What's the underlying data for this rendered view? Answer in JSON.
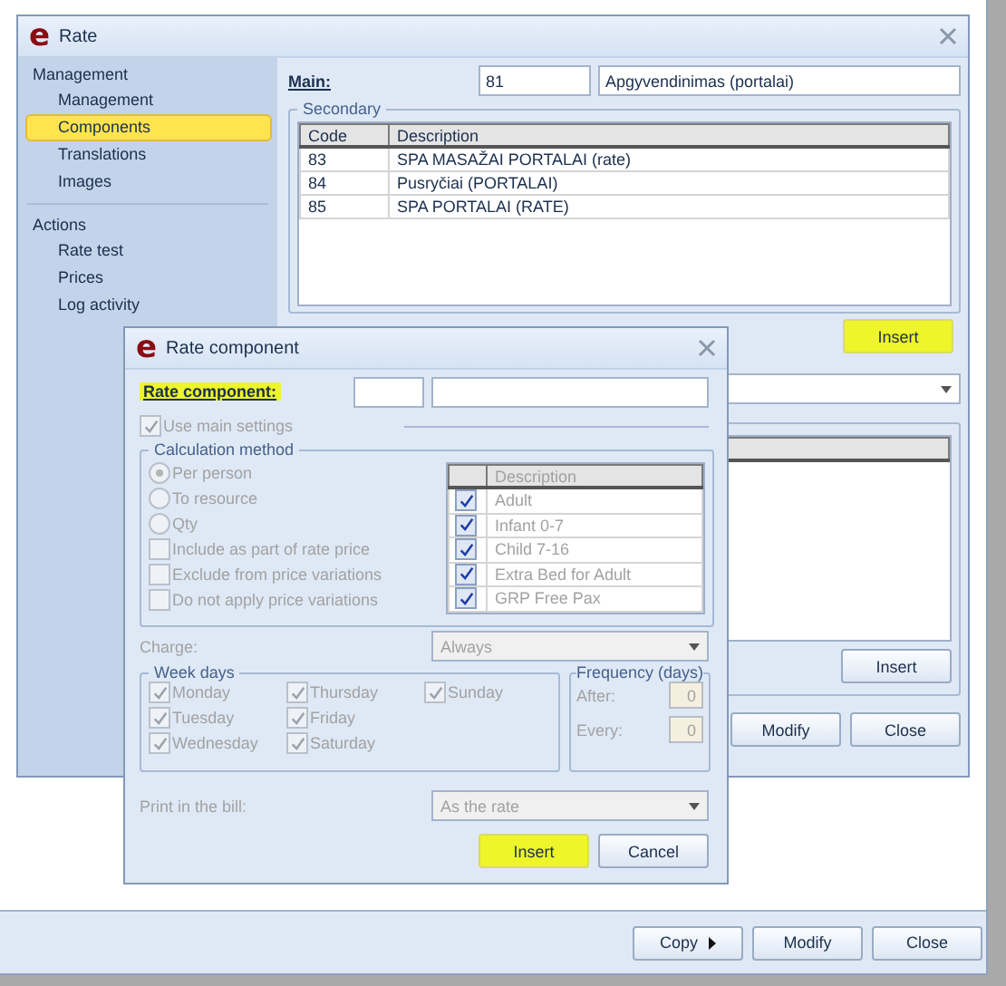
{
  "background_window": {
    "buttons": [
      {
        "label": "Copy",
        "kind": "menu"
      },
      {
        "label": "Modify",
        "kind": "plain"
      },
      {
        "label": "Close",
        "kind": "plain"
      }
    ]
  },
  "rate_window": {
    "logo": "e",
    "title": "Rate",
    "sidebar": {
      "sections": [
        {
          "heading": "Management",
          "items": [
            {
              "label": "Management",
              "selected": false
            },
            {
              "label": "Components",
              "selected": true
            },
            {
              "label": "Translations",
              "selected": false
            },
            {
              "label": "Images",
              "selected": false
            }
          ]
        },
        {
          "heading": "Actions",
          "items": [
            {
              "label": "Rate test",
              "selected": false
            },
            {
              "label": "Prices",
              "selected": false
            },
            {
              "label": "Log activity",
              "selected": false
            }
          ]
        }
      ]
    },
    "main": {
      "label": "Main:",
      "code": "81",
      "description": "Apgyvendinimas (portalai)"
    },
    "secondary": {
      "legend": "Secondary",
      "columns": [
        "Code",
        "Description"
      ],
      "rows": [
        [
          "83",
          "SPA MASAŽAI PORTALAI (rate)"
        ],
        [
          "84",
          "Pusryčiai (PORTALAI)"
        ],
        [
          "85",
          "SPA PORTALAI (RATE)"
        ]
      ],
      "insert_button": {
        "label": "Insert",
        "highlighted": true
      }
    },
    "lower_insert_button": {
      "label": "Insert",
      "highlighted": false
    },
    "buttons": [
      {
        "label": "Modify",
        "highlighted": false
      },
      {
        "label": "Close",
        "highlighted": false
      }
    ]
  },
  "dialog": {
    "logo": "e",
    "title": "Rate component",
    "label": "Rate component:",
    "label_highlighted": true,
    "settings_disabled": true,
    "use_main_settings": {
      "label": "Use main settings",
      "checked": true
    },
    "calculation": {
      "legend": "Calculation method",
      "options": [
        {
          "kind": "radio",
          "label": "Per person",
          "selected": true
        },
        {
          "kind": "radio",
          "label": "To resource",
          "selected": false
        },
        {
          "kind": "radio",
          "label": "Qty",
          "selected": false
        },
        {
          "kind": "checkbox",
          "label": "Include as part of rate price",
          "checked": false
        },
        {
          "kind": "checkbox",
          "label": "Exclude from price variations",
          "checked": false
        },
        {
          "kind": "checkbox",
          "label": "Do not apply price variations",
          "checked": false
        }
      ],
      "table": {
        "column": "Description",
        "rows": [
          {
            "label": "Adult",
            "checked": true
          },
          {
            "label": "Infant 0-7",
            "checked": true
          },
          {
            "label": "Child 7-16",
            "checked": true
          },
          {
            "label": "Extra Bed for Adult",
            "checked": true
          },
          {
            "label": "GRP Free Pax",
            "checked": true
          }
        ]
      }
    },
    "charge": {
      "label": "Charge:",
      "value": "Always"
    },
    "week_days": {
      "legend": "Week days",
      "days": [
        {
          "label": "Monday",
          "checked": true
        },
        {
          "label": "Tuesday",
          "checked": true
        },
        {
          "label": "Wednesday",
          "checked": true
        },
        {
          "label": "Thursday",
          "checked": true
        },
        {
          "label": "Friday",
          "checked": true
        },
        {
          "label": "Saturday",
          "checked": true
        },
        {
          "label": "Sunday",
          "checked": true
        }
      ]
    },
    "frequency": {
      "legend": "Frequency (days)",
      "after": {
        "label": "After:",
        "value": "0"
      },
      "every": {
        "label": "Every:",
        "value": "0"
      }
    },
    "print": {
      "label": "Print in the bill:",
      "value": "As the rate"
    },
    "buttons": [
      {
        "label": "Insert",
        "highlighted": true
      },
      {
        "label": "Cancel",
        "highlighted": false
      }
    ]
  }
}
